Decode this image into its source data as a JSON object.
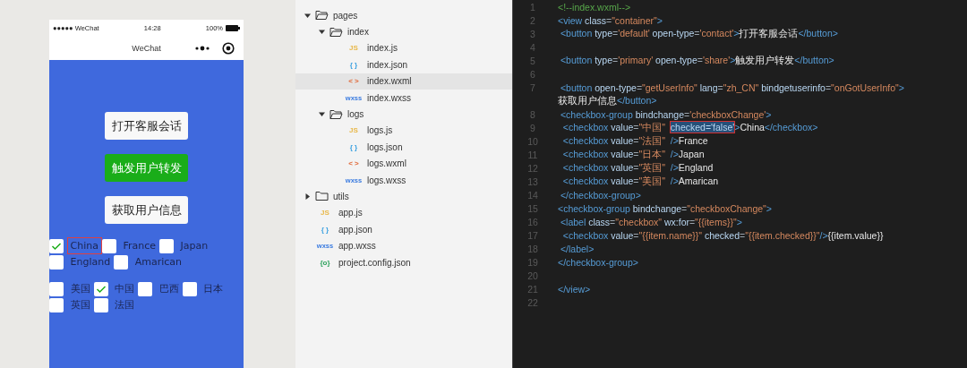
{
  "phone": {
    "status_bar": {
      "carrier": "●●●●● WeChat",
      "time": "14:28",
      "battery": "100%"
    },
    "nav_title": "WeChat",
    "buttons": [
      {
        "label": "打开客服会话",
        "kind": "default"
      },
      {
        "label": "触发用户转发",
        "kind": "primary"
      },
      {
        "label": "获取用户信息",
        "kind": "default"
      }
    ],
    "checkbox_groups": [
      [
        {
          "label": "China",
          "checked": true,
          "annotated": true
        },
        {
          "label": "France",
          "checked": false,
          "annotated": false
        },
        {
          "label": "Japan",
          "checked": false,
          "annotated": false
        },
        {
          "label": "England",
          "checked": false,
          "annotated": false
        },
        {
          "label": "Amarican",
          "checked": false,
          "annotated": false
        }
      ],
      [
        {
          "label": "美国",
          "checked": false,
          "annotated": false
        },
        {
          "label": "中国",
          "checked": true,
          "annotated": false
        },
        {
          "label": "巴西",
          "checked": false,
          "annotated": false
        },
        {
          "label": "日本",
          "checked": false,
          "annotated": false
        },
        {
          "label": "英国",
          "checked": false,
          "annotated": false
        },
        {
          "label": "法国",
          "checked": false,
          "annotated": false
        }
      ]
    ]
  },
  "file_tree": [
    {
      "name": "pages",
      "kind": "folder",
      "expanded": true,
      "selected": false,
      "children": [
        {
          "name": "index",
          "kind": "folder",
          "expanded": true,
          "selected": false,
          "children": [
            {
              "name": "index.js",
              "kind": "js",
              "badge": "JS",
              "selected": false
            },
            {
              "name": "index.json",
              "kind": "json",
              "badge": "{ }",
              "selected": false
            },
            {
              "name": "index.wxml",
              "kind": "wxml",
              "badge": "< >",
              "selected": true
            },
            {
              "name": "index.wxss",
              "kind": "wxss",
              "badge": "wxss",
              "selected": false
            }
          ]
        },
        {
          "name": "logs",
          "kind": "folder",
          "expanded": true,
          "selected": false,
          "children": [
            {
              "name": "logs.js",
              "kind": "js",
              "badge": "JS",
              "selected": false
            },
            {
              "name": "logs.json",
              "kind": "json",
              "badge": "{ }",
              "selected": false
            },
            {
              "name": "logs.wxml",
              "kind": "wxml",
              "badge": "< >",
              "selected": false
            },
            {
              "name": "logs.wxss",
              "kind": "wxss",
              "badge": "wxss",
              "selected": false
            }
          ]
        }
      ]
    },
    {
      "name": "utils",
      "kind": "folder",
      "expanded": false,
      "selected": false
    },
    {
      "name": "app.js",
      "kind": "js",
      "badge": "JS",
      "selected": false
    },
    {
      "name": "app.json",
      "kind": "json",
      "badge": "{ }",
      "selected": false
    },
    {
      "name": "app.wxss",
      "kind": "wxss",
      "badge": "wxss",
      "selected": false
    },
    {
      "name": "project.config.json",
      "kind": "config",
      "badge": "{o}",
      "selected": false
    }
  ],
  "editor": {
    "lines": [
      {
        "number": "1",
        "tokens": [
          {
            "kind": "cm",
            "t": "<!--index.wxml-->"
          }
        ]
      },
      {
        "number": "2",
        "tokens": [
          {
            "kind": "tag",
            "t": "<view"
          },
          {
            "kind": "attr",
            "t": " class"
          },
          {
            "kind": "p",
            "t": "="
          },
          {
            "kind": "str",
            "t": "\"container\""
          },
          {
            "kind": "tag",
            "t": ">"
          }
        ]
      },
      {
        "number": "3",
        "tokens": [
          {
            "kind": "tag",
            "t": " <button"
          },
          {
            "kind": "attr",
            "t": " type"
          },
          {
            "kind": "p",
            "t": "="
          },
          {
            "kind": "str",
            "t": "'default'"
          },
          {
            "kind": "attr",
            "t": " open-type"
          },
          {
            "kind": "p",
            "t": "="
          },
          {
            "kind": "str",
            "t": "'contact'"
          },
          {
            "kind": "tag",
            "t": ">"
          },
          {
            "kind": "txt",
            "t": "打开客服会话"
          },
          {
            "kind": "tag",
            "t": "</button>"
          }
        ]
      },
      {
        "number": "4"
      },
      {
        "number": "5",
        "tokens": [
          {
            "kind": "tag",
            "t": " <button"
          },
          {
            "kind": "attr",
            "t": " type"
          },
          {
            "kind": "p",
            "t": "="
          },
          {
            "kind": "str",
            "t": "'primary'"
          },
          {
            "kind": "attr",
            "t": " open-type"
          },
          {
            "kind": "p",
            "t": "="
          },
          {
            "kind": "str",
            "t": "'share'"
          },
          {
            "kind": "tag",
            "t": ">"
          },
          {
            "kind": "txt",
            "t": "触发用户转发"
          },
          {
            "kind": "tag",
            "t": "</button>"
          }
        ]
      },
      {
        "number": "6"
      },
      {
        "number": "7",
        "tokens": [
          {
            "kind": "tag",
            "t": " <button"
          },
          {
            "kind": "attr",
            "t": " open-type"
          },
          {
            "kind": "p",
            "t": "="
          },
          {
            "kind": "str",
            "t": "\"getUserInfo\""
          },
          {
            "kind": "attr",
            "t": " lang"
          },
          {
            "kind": "p",
            "t": "="
          },
          {
            "kind": "str",
            "t": "\"zh_CN\""
          },
          {
            "kind": "attr",
            "t": " bindgetuserinfo"
          },
          {
            "kind": "p",
            "t": "="
          },
          {
            "kind": "str",
            "t": "\"onGotUserInfo\""
          },
          {
            "kind": "tag",
            "t": ">"
          }
        ]
      },
      {
        "tokens": [
          {
            "kind": "txt",
            "t": "获取用户信息"
          },
          {
            "kind": "tag",
            "t": "</button>"
          }
        ]
      },
      {
        "number": "8",
        "tokens": [
          {
            "kind": "tag",
            "t": " <checkbox-group"
          },
          {
            "kind": "attr",
            "t": " bindchange"
          },
          {
            "kind": "p",
            "t": "="
          },
          {
            "kind": "str",
            "t": "'checkboxChange'"
          },
          {
            "kind": "tag",
            "t": ">"
          }
        ]
      },
      {
        "number": "9",
        "tokens": [
          {
            "kind": "tag",
            "t": "  <checkbox"
          },
          {
            "kind": "attr",
            "t": " value"
          },
          {
            "kind": "p",
            "t": "="
          },
          {
            "kind": "str",
            "t": "\"中国\"  "
          },
          {
            "kind": "sel",
            "t": "checked='false'"
          },
          {
            "kind": "tag",
            "t": ">"
          },
          {
            "kind": "txt",
            "t": "China"
          },
          {
            "kind": "tag",
            "t": "</checkbox>"
          }
        ]
      },
      {
        "number": "10",
        "tokens": [
          {
            "kind": "tag",
            "t": "  <checkbox"
          },
          {
            "kind": "attr",
            "t": " value"
          },
          {
            "kind": "p",
            "t": "="
          },
          {
            "kind": "str",
            "t": "\"法国\""
          },
          {
            "kind": "tag",
            "t": "  />"
          },
          {
            "kind": "txt",
            "t": "France"
          }
        ]
      },
      {
        "number": "11",
        "tokens": [
          {
            "kind": "tag",
            "t": "  <checkbox"
          },
          {
            "kind": "attr",
            "t": " value"
          },
          {
            "kind": "p",
            "t": "="
          },
          {
            "kind": "str",
            "t": "\"日本\""
          },
          {
            "kind": "tag",
            "t": "  />"
          },
          {
            "kind": "txt",
            "t": "Japan"
          }
        ]
      },
      {
        "number": "12",
        "tokens": [
          {
            "kind": "tag",
            "t": "  <checkbox"
          },
          {
            "kind": "attr",
            "t": " value"
          },
          {
            "kind": "p",
            "t": "="
          },
          {
            "kind": "str",
            "t": "\"英国\""
          },
          {
            "kind": "tag",
            "t": "  />"
          },
          {
            "kind": "txt",
            "t": "England"
          }
        ]
      },
      {
        "number": "13",
        "tokens": [
          {
            "kind": "tag",
            "t": "  <checkbox"
          },
          {
            "kind": "attr",
            "t": " value"
          },
          {
            "kind": "p",
            "t": "="
          },
          {
            "kind": "str",
            "t": "\"美国\""
          },
          {
            "kind": "tag",
            "t": "  />"
          },
          {
            "kind": "txt",
            "t": "Amarican"
          }
        ]
      },
      {
        "number": "14",
        "tokens": [
          {
            "kind": "tag",
            "t": " </checkbox-group>"
          }
        ]
      },
      {
        "number": "15",
        "tokens": [
          {
            "kind": "tag",
            "t": "<checkbox-group"
          },
          {
            "kind": "attr",
            "t": " bindchange"
          },
          {
            "kind": "p",
            "t": "="
          },
          {
            "kind": "str",
            "t": "\"checkboxChange\""
          },
          {
            "kind": "tag",
            "t": ">"
          }
        ]
      },
      {
        "number": "16",
        "tokens": [
          {
            "kind": "tag",
            "t": " <label"
          },
          {
            "kind": "attr",
            "t": " class"
          },
          {
            "kind": "p",
            "t": "="
          },
          {
            "kind": "str",
            "t": "\"checkbox\""
          },
          {
            "kind": "attr",
            "t": " wx:for"
          },
          {
            "kind": "p",
            "t": "="
          },
          {
            "kind": "str",
            "t": "\"{{items}}\""
          },
          {
            "kind": "tag",
            "t": ">"
          }
        ]
      },
      {
        "number": "17",
        "tokens": [
          {
            "kind": "tag",
            "t": "  <checkbox"
          },
          {
            "kind": "attr",
            "t": " value"
          },
          {
            "kind": "p",
            "t": "="
          },
          {
            "kind": "str",
            "t": "\"{{item.name}}\""
          },
          {
            "kind": "attr",
            "t": " checked"
          },
          {
            "kind": "p",
            "t": "="
          },
          {
            "kind": "str",
            "t": "\"{{item.checked}}\""
          },
          {
            "kind": "tag",
            "t": "/>"
          },
          {
            "kind": "txt",
            "t": "{{item.value}}"
          }
        ]
      },
      {
        "number": "18",
        "tokens": [
          {
            "kind": "tag",
            "t": " </label>"
          }
        ]
      },
      {
        "number": "19",
        "tokens": [
          {
            "kind": "tag",
            "t": "</checkbox-group>"
          }
        ]
      },
      {
        "number": "20"
      },
      {
        "number": "21",
        "tokens": [
          {
            "kind": "tag",
            "t": "</view>"
          }
        ]
      },
      {
        "number": "22"
      }
    ]
  }
}
